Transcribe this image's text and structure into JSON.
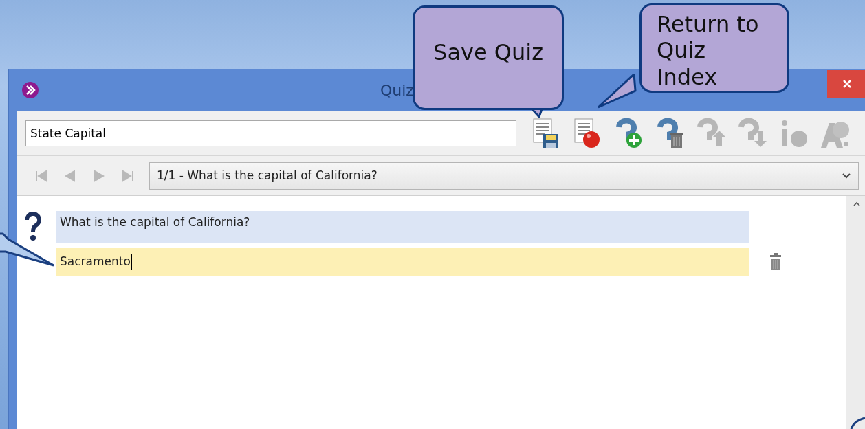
{
  "window": {
    "title": "Quiz"
  },
  "quiz_name": {
    "value": "State Capital"
  },
  "toolbar": [
    {
      "disabled": false
    },
    {
      "disabled": false
    },
    {
      "disabled": false
    },
    {
      "disabled": false
    },
    {
      "disabled": true
    },
    {
      "disabled": true
    },
    {
      "disabled": true
    },
    {
      "disabled": true
    }
  ],
  "nav_buttons": [
    {
      "disabled": true
    },
    {
      "disabled": true
    },
    {
      "disabled": true
    },
    {
      "disabled": true
    }
  ],
  "question_selector": {
    "value": "1/1 - What is the capital of California?"
  },
  "question": {
    "text": "What is the capital of California?"
  },
  "answers": [
    {
      "value": "Sacramento",
      "focused": true
    }
  ],
  "callouts": [
    {
      "text": "Save Quiz"
    },
    {
      "text": "Return to Quiz Index"
    }
  ]
}
